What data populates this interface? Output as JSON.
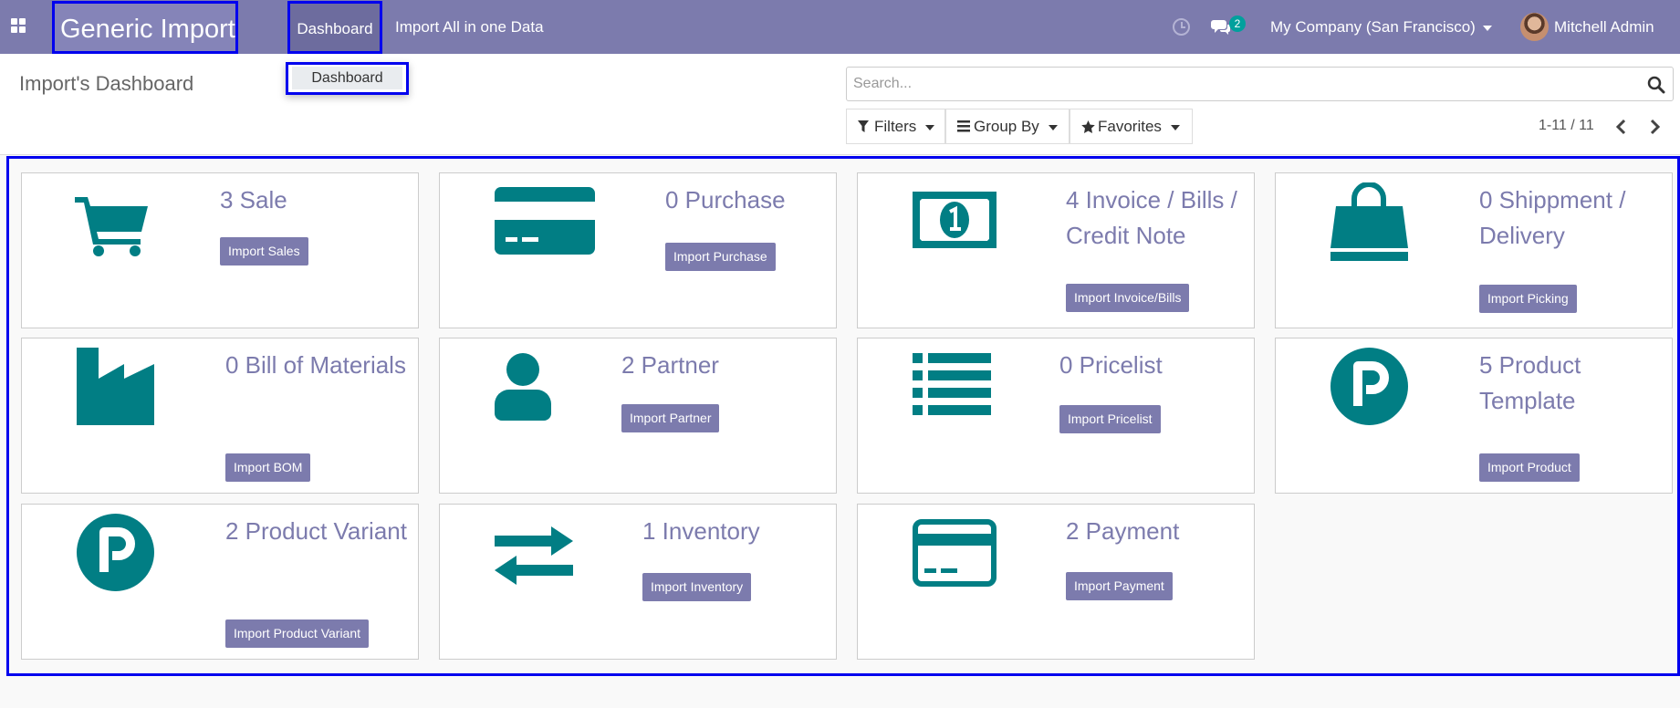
{
  "navbar": {
    "app_name": "Generic Import",
    "menu_dashboard": "Dashboard",
    "menu_import_all": "Import All in one Data",
    "chat_count": "2",
    "company": "My Company (San Francisco)",
    "user": "Mitchell Admin"
  },
  "dropdown": {
    "item": "Dashboard"
  },
  "control_panel": {
    "title": "Import's Dashboard",
    "search_placeholder": "Search...",
    "filters": "Filters",
    "group_by": "Group By",
    "favorites": "Favorites",
    "pager": "1-11 / 11"
  },
  "cards": [
    {
      "title": "3 Sale",
      "button": "Import Sales",
      "icon": "cart-icon"
    },
    {
      "title": "0 Purchase",
      "button": "Import Purchase",
      "icon": "credit-card-icon"
    },
    {
      "title": "4 Invoice / Bills / Credit Note",
      "button": "Import Invoice/Bills",
      "icon": "money-bill-icon"
    },
    {
      "title": "0 Shippment / Delivery",
      "button": "Import Picking",
      "icon": "shopping-bag-icon"
    },
    {
      "title": "0 Bill of Materials",
      "button": "Import BOM",
      "icon": "factory-icon"
    },
    {
      "title": "2 Partner",
      "button": "Import Partner",
      "icon": "user-icon"
    },
    {
      "title": "0 Pricelist",
      "button": "Import Pricelist",
      "icon": "list-icon"
    },
    {
      "title": "5 Product Template",
      "button": "Import Product",
      "icon": "parking-circle-icon"
    },
    {
      "title": "2 Product Variant",
      "button": "Import Product Variant",
      "icon": "parking-circle-icon"
    },
    {
      "title": "1 Inventory",
      "button": "Import Inventory",
      "icon": "exchange-arrows-icon"
    },
    {
      "title": "2 Payment",
      "button": "Import Payment",
      "icon": "credit-card-outline-icon"
    }
  ],
  "colors": {
    "navbar": "#7c7bad",
    "accent": "#7c7bad",
    "icon": "#017e84",
    "badge": "#00a09d",
    "highlight": "#0000ee"
  }
}
